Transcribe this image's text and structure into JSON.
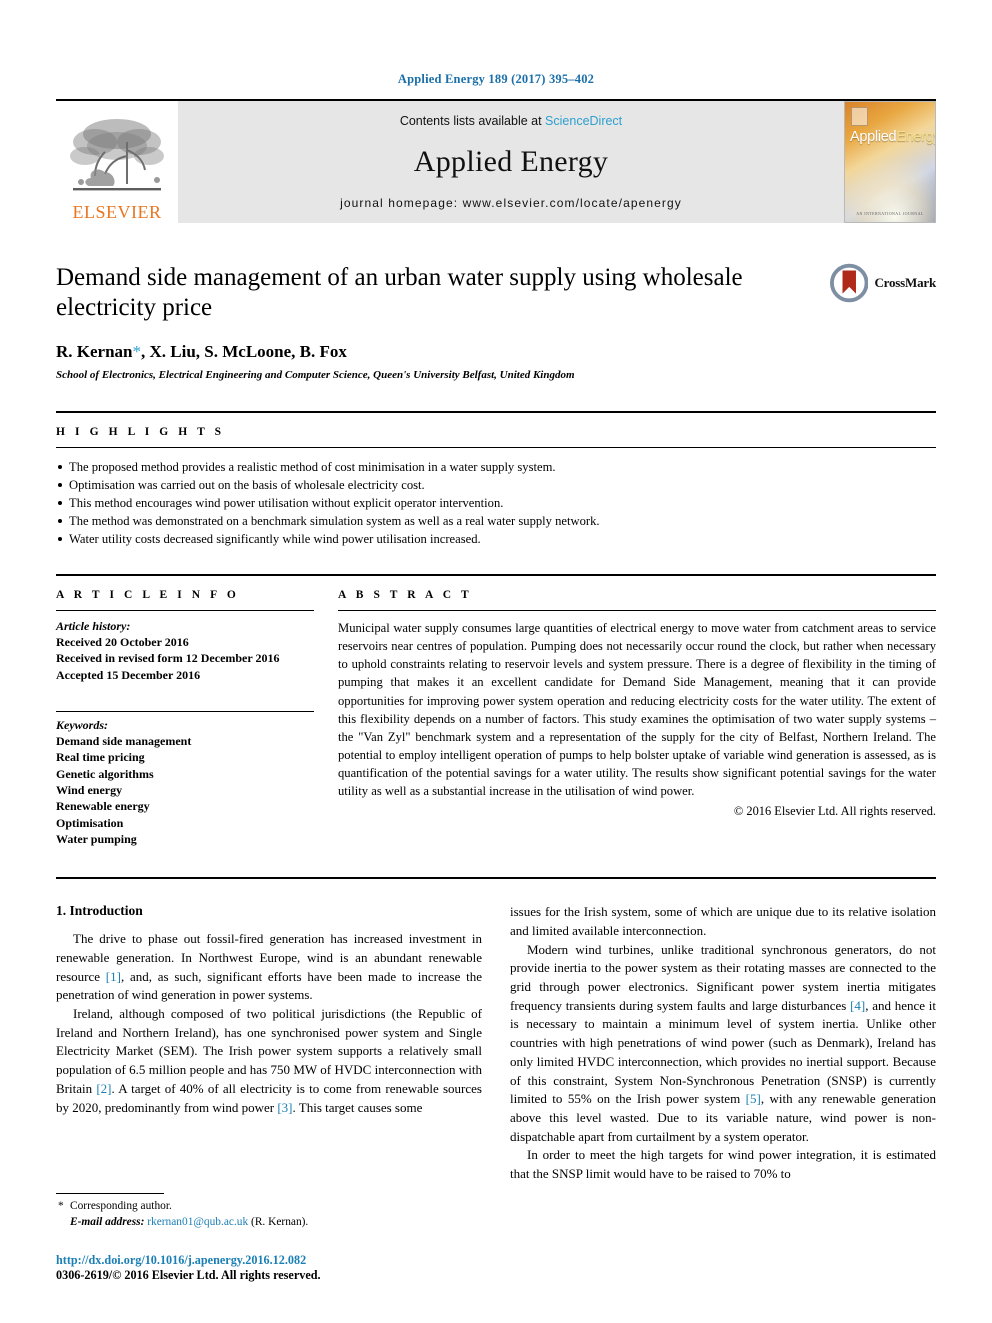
{
  "running_head": "Applied Energy 189 (2017) 395–402",
  "masthead": {
    "publisher_wordmark": "ELSEVIER",
    "contents_prefix": "Contents lists available at ",
    "contents_link": "ScienceDirect",
    "journal_title": "Applied Energy",
    "homepage": "journal homepage: www.elsevier.com/locate/apenergy",
    "cover_title_part1": "Applied",
    "cover_title_part2": "Energy",
    "cover_footer": "AN INTERNATIONAL JOURNAL"
  },
  "article": {
    "title": "Demand side management of an urban water supply using wholesale electricity price",
    "authors": "R. Kernan",
    "authors_rest": ", X. Liu, S. McLoone, B. Fox",
    "corresponding_marker": "*",
    "affiliation": "School of Electronics, Electrical Engineering and Computer Science, Queen's University Belfast, United Kingdom",
    "crossmark_label": "CrossMark"
  },
  "highlights": {
    "label": "H I G H L I G H T S",
    "items": [
      "The proposed method provides a realistic method of cost minimisation in a water supply system.",
      "Optimisation was carried out on the basis of wholesale electricity cost.",
      "This method encourages wind power utilisation without explicit operator intervention.",
      "The method was demonstrated on a benchmark simulation system as well as a real water supply network.",
      "Water utility costs decreased significantly while wind power utilisation increased."
    ]
  },
  "article_info": {
    "label": "A R T I C L E    I N F O",
    "history_head": "Article history:",
    "history": [
      "Received 20 October 2016",
      "Received in revised form 12 December 2016",
      "Accepted 15 December 2016"
    ],
    "keywords_head": "Keywords:",
    "keywords": [
      "Demand side management",
      "Real time pricing",
      "Genetic algorithms",
      "Wind energy",
      "Renewable energy",
      "Optimisation",
      "Water pumping"
    ]
  },
  "abstract": {
    "label": "A B S T R A C T",
    "text": "Municipal water supply consumes large quantities of electrical energy to move water from catchment areas to service reservoirs near centres of population. Pumping does not necessarily occur round the clock, but rather when necessary to uphold constraints relating to reservoir levels and system pressure. There is a degree of flexibility in the timing of pumping that makes it an excellent candidate for Demand Side Management, meaning that it can provide opportunities for improving power system operation and reducing electricity costs for the water utility. The extent of this flexibility depends on a number of factors. This study examines the optimisation of two water supply systems – the \"Van Zyl\" benchmark system and a representation of the supply for the city of Belfast, Northern Ireland. The potential to employ intelligent operation of pumps to help bolster uptake of variable wind generation is assessed, as is quantification of the potential savings for a water utility. The results show significant potential savings for the water utility as well as a substantial increase in the utilisation of wind power.",
    "copyright": "© 2016 Elsevier Ltd. All rights reserved."
  },
  "introduction": {
    "heading": "1. Introduction",
    "left_paragraphs": [
      {
        "pre": "The drive to phase out fossil-fired generation has increased investment in renewable generation. In Northwest Europe, wind is an abundant renewable resource ",
        "cite": "[1]",
        "post": ", and, as such, significant efforts have been made to increase the penetration of wind generation in power systems."
      }
    ],
    "left_para2": {
      "pre": "Ireland, although composed of two political jurisdictions (the Republic of Ireland and Northern Ireland), has one synchronised power system and Single Electricity Market (SEM). The Irish power system supports a relatively small population of 6.5 million people and has 750 MW of HVDC interconnection with Britain ",
      "cite1": "[2]",
      "mid": ". A target of 40% of all electricity is to come from renewable sources by 2020, predominantly from wind power ",
      "cite2": "[3]",
      "post": ". This target causes some"
    },
    "right_para1": "issues for the Irish system, some of which are unique due to its relative isolation and limited available interconnection.",
    "right_para2": {
      "pre": "Modern wind turbines, unlike traditional synchronous generators, do not provide inertia to the power system as their rotating masses are connected to the grid through power electronics. Significant power system inertia mitigates frequency transients during system faults and large disturbances ",
      "cite1": "[4]",
      "mid": ", and hence it is necessary to maintain a minimum level of system inertia. Unlike other countries with high penetrations of wind power (such as Denmark), Ireland has only limited HVDC interconnection, which provides no inertial support. Because of this constraint, System Non-Synchronous Penetration (SNSP) is currently limited to 55% on the Irish power system ",
      "cite2": "[5]",
      "post": ", with any renewable generation above this level wasted. Due to its variable nature, wind power is non-dispatchable apart from curtailment by a system operator."
    },
    "right_para3": "In order to meet the high targets for wind power integration, it is estimated that the SNSP limit would have to be raised to 70% to"
  },
  "footer": {
    "corresponding_star": "*",
    "corresponding_label": "Corresponding author.",
    "email_label": "E-mail address:",
    "email": "rkernan01@qub.ac.uk",
    "email_owner": "(R. Kernan).",
    "doi": "http://dx.doi.org/10.1016/j.apenergy.2016.12.082",
    "issn": "0306-2619/© 2016 Elsevier Ltd. All rights reserved."
  },
  "colors": {
    "link_blue": "#1a7fb5",
    "sciencedirect_blue": "#2f9fd0",
    "elsevier_orange": "#E87722",
    "masthead_gray": "#e6e6e6"
  }
}
